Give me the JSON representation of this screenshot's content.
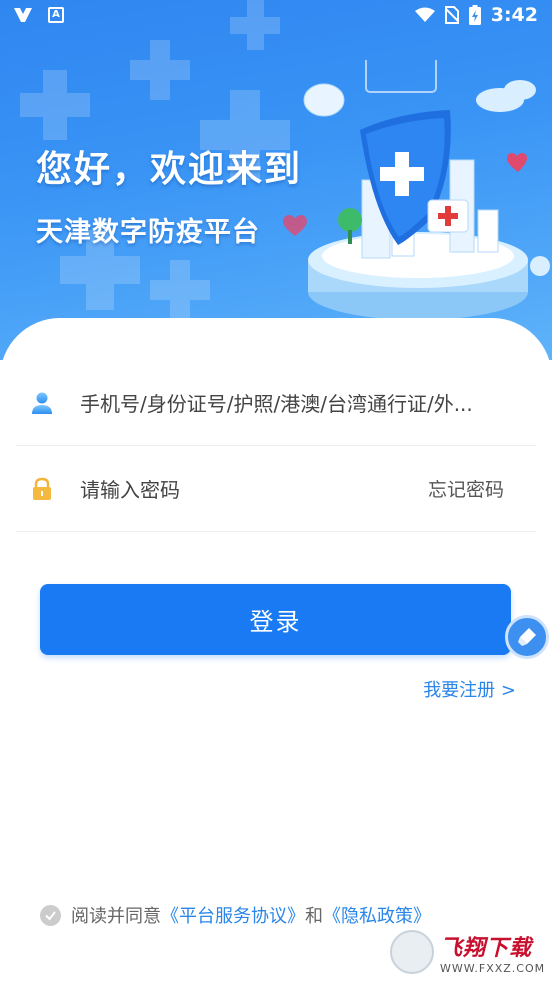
{
  "status_bar": {
    "time": "3:42",
    "left_icons": [
      "app-logo-icon",
      "text-a-icon"
    ],
    "right_icons": [
      "wifi-icon",
      "no-sim-icon",
      "battery-charging-icon"
    ]
  },
  "hero": {
    "greeting": "您好，欢迎来到",
    "platform_name": "天津数字防疫平台"
  },
  "form": {
    "account_placeholder": "手机号/身份证号/护照/港澳/台湾通行证/外...",
    "password_placeholder": "请输入密码",
    "forgot_password": "忘记密码",
    "login_button": "登录",
    "register_link": "我要注册 >"
  },
  "agreement": {
    "prefix": "阅读并同意",
    "service_link": "《平台服务协议》",
    "and": "和",
    "privacy_link": "《隐私政策》"
  },
  "watermark": {
    "brand": "飞翔下载",
    "url": "WWW.FXXZ.COM"
  },
  "colors": {
    "primary": "#1a7af3",
    "link": "#2a86e8",
    "hero_gradient_start": "#2f86f0",
    "hero_gradient_end": "#5fb3fa"
  }
}
